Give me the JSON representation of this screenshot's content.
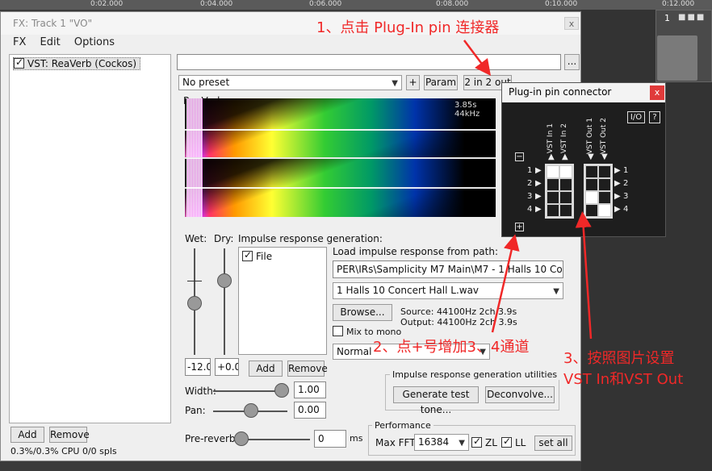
{
  "daw": {
    "timeline_ticks": [
      "0:02.000",
      "0:04.000",
      "0:06.000",
      "0:08.000",
      "0:10.000",
      "0:12.000"
    ],
    "track_number": "1"
  },
  "fx_window": {
    "title": "FX: Track 1 \"VO\"",
    "close": "x",
    "menu": [
      "FX",
      "Edit",
      "Options"
    ],
    "fx_list": [
      {
        "label": "VST: ReaVerb (Cockos)",
        "checked": true
      }
    ],
    "add_button": "Add",
    "remove_button": "Remove",
    "cpu_status": "0.3%/0.3% CPU 0/0 spls",
    "ellipsis_button": "...",
    "preset": "No preset",
    "plus_button": "+",
    "param_button": "Param",
    "io_button": "2 in 2 out",
    "plugin_name": "ReaVerb"
  },
  "reaverb": {
    "spectrogram_info": "3.85s 44kHz",
    "wet_label": "Wet:",
    "dry_label": "Dry:",
    "wet_value": "-12.0",
    "dry_value": "+0.0",
    "ir_gen_label": "Impulse response generation:",
    "ir_file_item": "File",
    "ir_add": "Add",
    "ir_remove": "Remove",
    "load_path_label": "Load impulse response from path:",
    "path_value": "PER\\IRs\\Samplicity M7 Main\\M7 - 1 Halls 10 Concert Hall",
    "file_select": "1 Halls 10 Concert Hall L.wav",
    "browse_button": "Browse...",
    "source_info": "Source: 44100Hz 2ch 3.9s",
    "output_info": "Output: 44100Hz 2ch 3.9s",
    "mix_to_mono": "Mix to mono",
    "mode_select": "Normal",
    "width_label": "Width:",
    "width_value": "1.00",
    "pan_label": "Pan:",
    "pan_value": "0.00",
    "prereverb_label": "Pre-reverb:",
    "prereverb_value": "0",
    "prereverb_unit": "ms",
    "utilities_title": "Impulse response generation utilities",
    "generate_button": "Generate test tone...",
    "deconvolve_button": "Deconvolve...",
    "performance_title": "Performance",
    "maxfft_label": "Max FFT:",
    "maxfft_value": "16384",
    "zl_label": "ZL",
    "ll_label": "LL",
    "setall_button": "set all"
  },
  "pin_connector": {
    "title": "Plug-in pin connector",
    "close": "x",
    "io_button": "I/O",
    "help_button": "?",
    "vst_in_labels": [
      "VST In 1",
      "VST In 2"
    ],
    "vst_out_labels": [
      "VST Out 1",
      "VST Out 2"
    ],
    "rows": [
      "1",
      "2",
      "3",
      "4"
    ],
    "input_matrix": [
      [
        true,
        true
      ],
      [
        false,
        false
      ],
      [
        false,
        false
      ],
      [
        false,
        false
      ]
    ],
    "output_matrix": [
      [
        false,
        false
      ],
      [
        false,
        false
      ],
      [
        true,
        false
      ],
      [
        false,
        true
      ]
    ],
    "minus": "−",
    "plus": "+"
  },
  "annotations": {
    "step1": "1、点击 Plug-In pin 连接器",
    "step2": "2、点+号增加3、4通道",
    "step3_line1": "3、按照图片设置",
    "step3_line2": "VST In和VST Out",
    "color": "#f02828"
  }
}
